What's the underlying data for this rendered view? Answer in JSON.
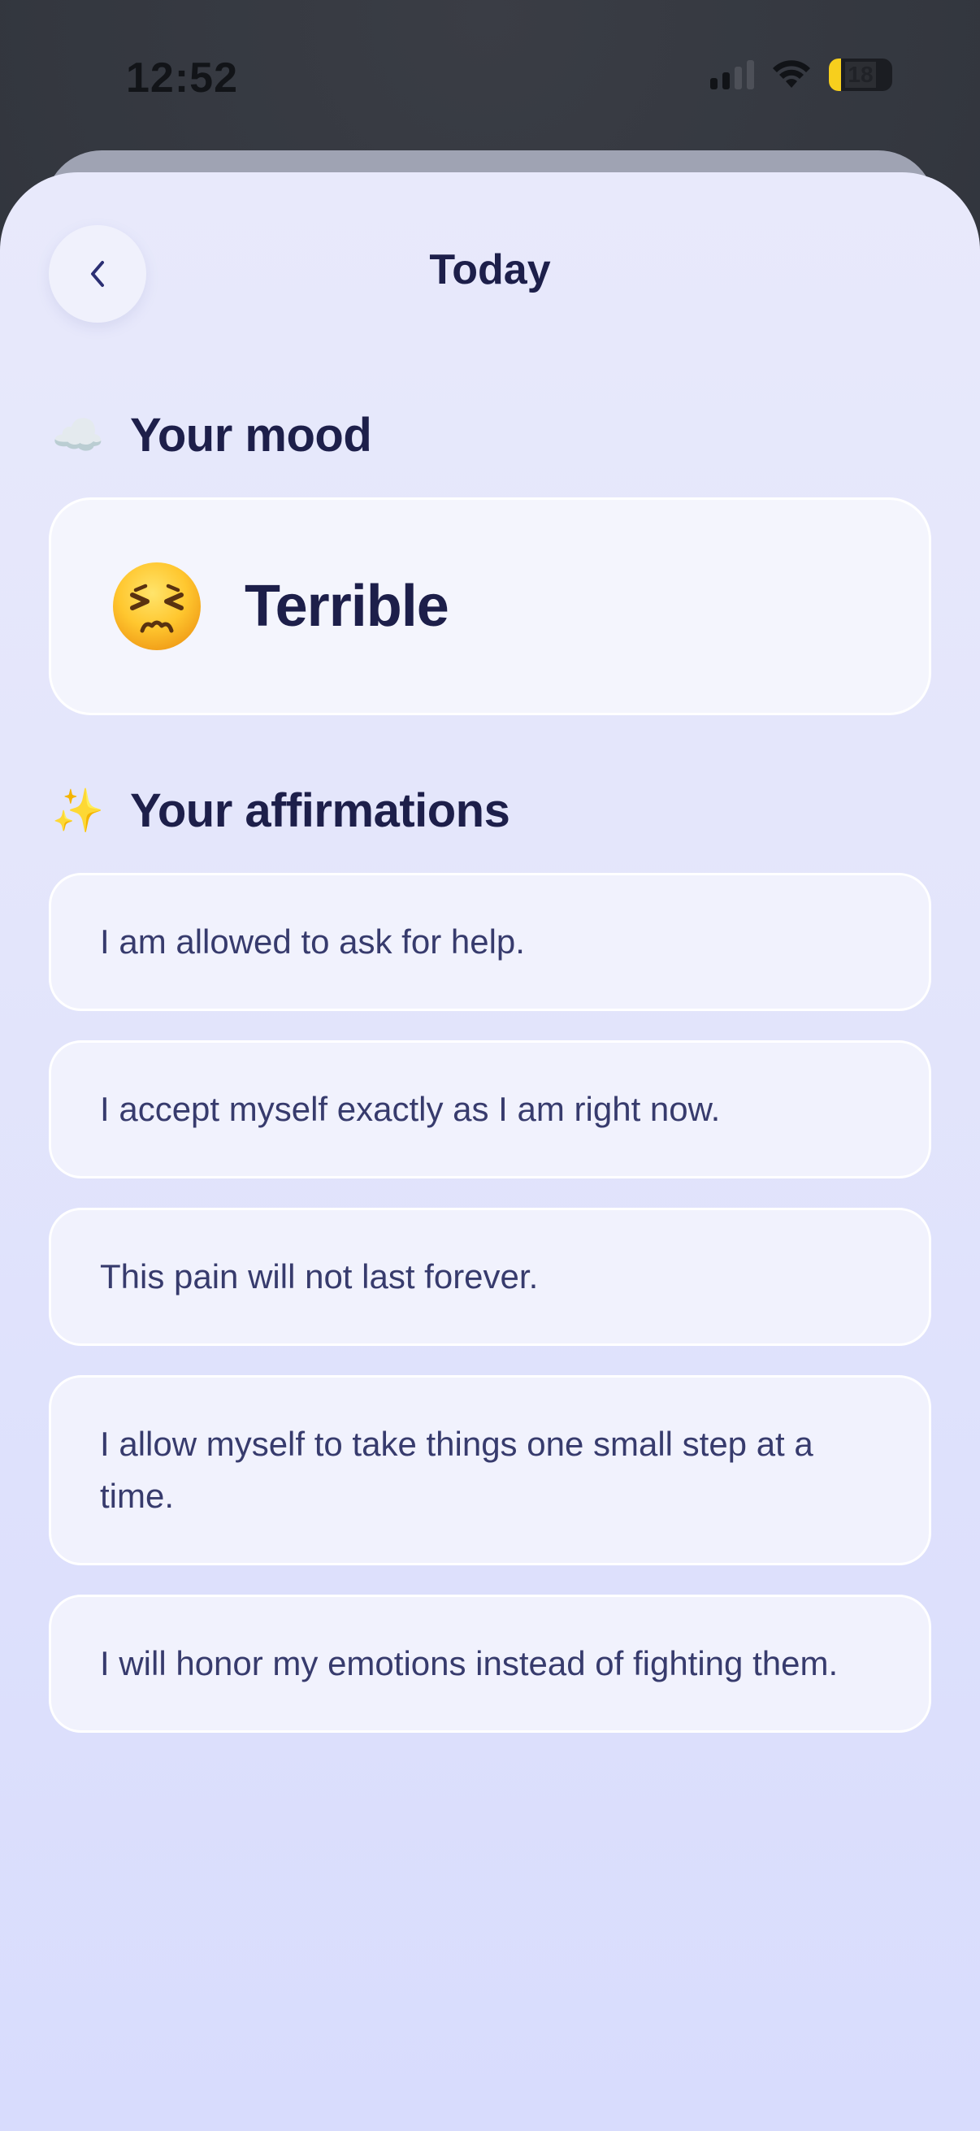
{
  "status_bar": {
    "time": "12:52",
    "battery_level": "18",
    "signal_icon": "cellular-signal-icon",
    "wifi_icon": "wifi-icon"
  },
  "header": {
    "title": "Today",
    "back_icon": "chevron-left-icon"
  },
  "mood_section": {
    "emoji": "☁️",
    "title": "Your mood",
    "mood": {
      "emoji_icon": "persevering-face-icon",
      "label": "Terrible"
    }
  },
  "affirmations_section": {
    "emoji": "✨",
    "title": "Your affirmations",
    "items": [
      "I am allowed to ask for help.",
      "I accept myself exactly as I am right now.",
      "This pain will not last forever.",
      "I allow myself to take things one small step at a time.",
      "I will honor my emotions instead of fighting them."
    ]
  },
  "colors": {
    "title_text": "#1d1f4a",
    "body_text": "#373b6d",
    "card_background": "#f4f5fd",
    "sheet_background": "#e3e5fb",
    "battery_accent": "#f7cf1d"
  }
}
